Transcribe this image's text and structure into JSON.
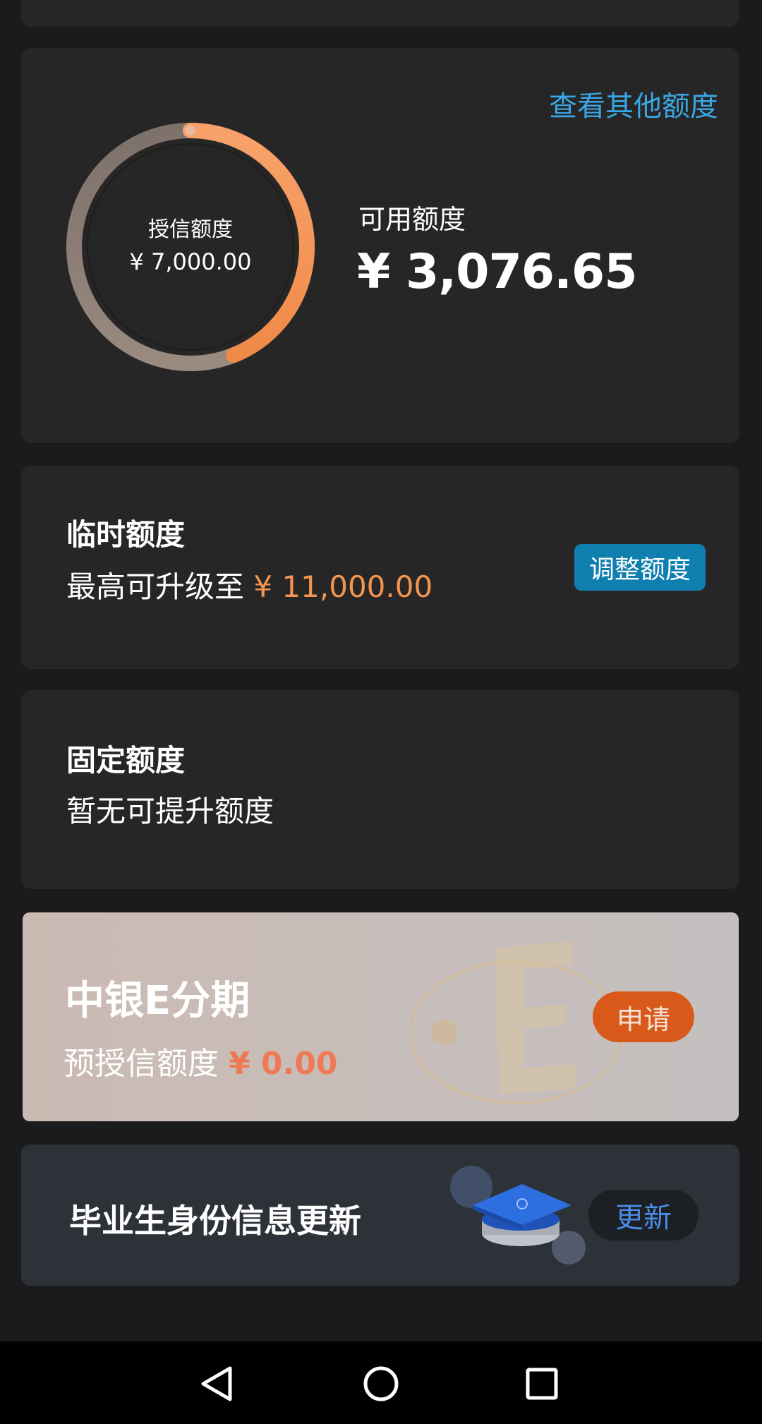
{
  "credit": {
    "link_other": "查看其他额度",
    "ring_label": "授信额度",
    "ring_value": "¥ 7,000.00",
    "available_label": "可用额度",
    "available_value": "¥ 3,076.65",
    "available_fraction": 0.4395,
    "ring_colors": {
      "used": "#8a7a70",
      "available": "#f59a5a"
    }
  },
  "temporary": {
    "title": "临时额度",
    "sub_prefix": "最高可升级至 ",
    "sub_amount": "¥ 11,000.00",
    "button": "调整额度"
  },
  "fixed": {
    "title": "固定额度",
    "sub": "暂无可提升额度"
  },
  "einstallment": {
    "title": "中银E分期",
    "sub_prefix": "预授信额度 ",
    "sub_amount": "¥ 0.00",
    "button": "申请",
    "deco_icon": "letter-e-orbit-icon"
  },
  "graduate": {
    "title": "毕业生身份信息更新",
    "button": "更新",
    "deco_icon": "graduation-cap-icon"
  },
  "navbar": {
    "back_icon": "back-triangle-icon",
    "home_icon": "home-circle-icon",
    "recent_icon": "recent-square-icon"
  }
}
